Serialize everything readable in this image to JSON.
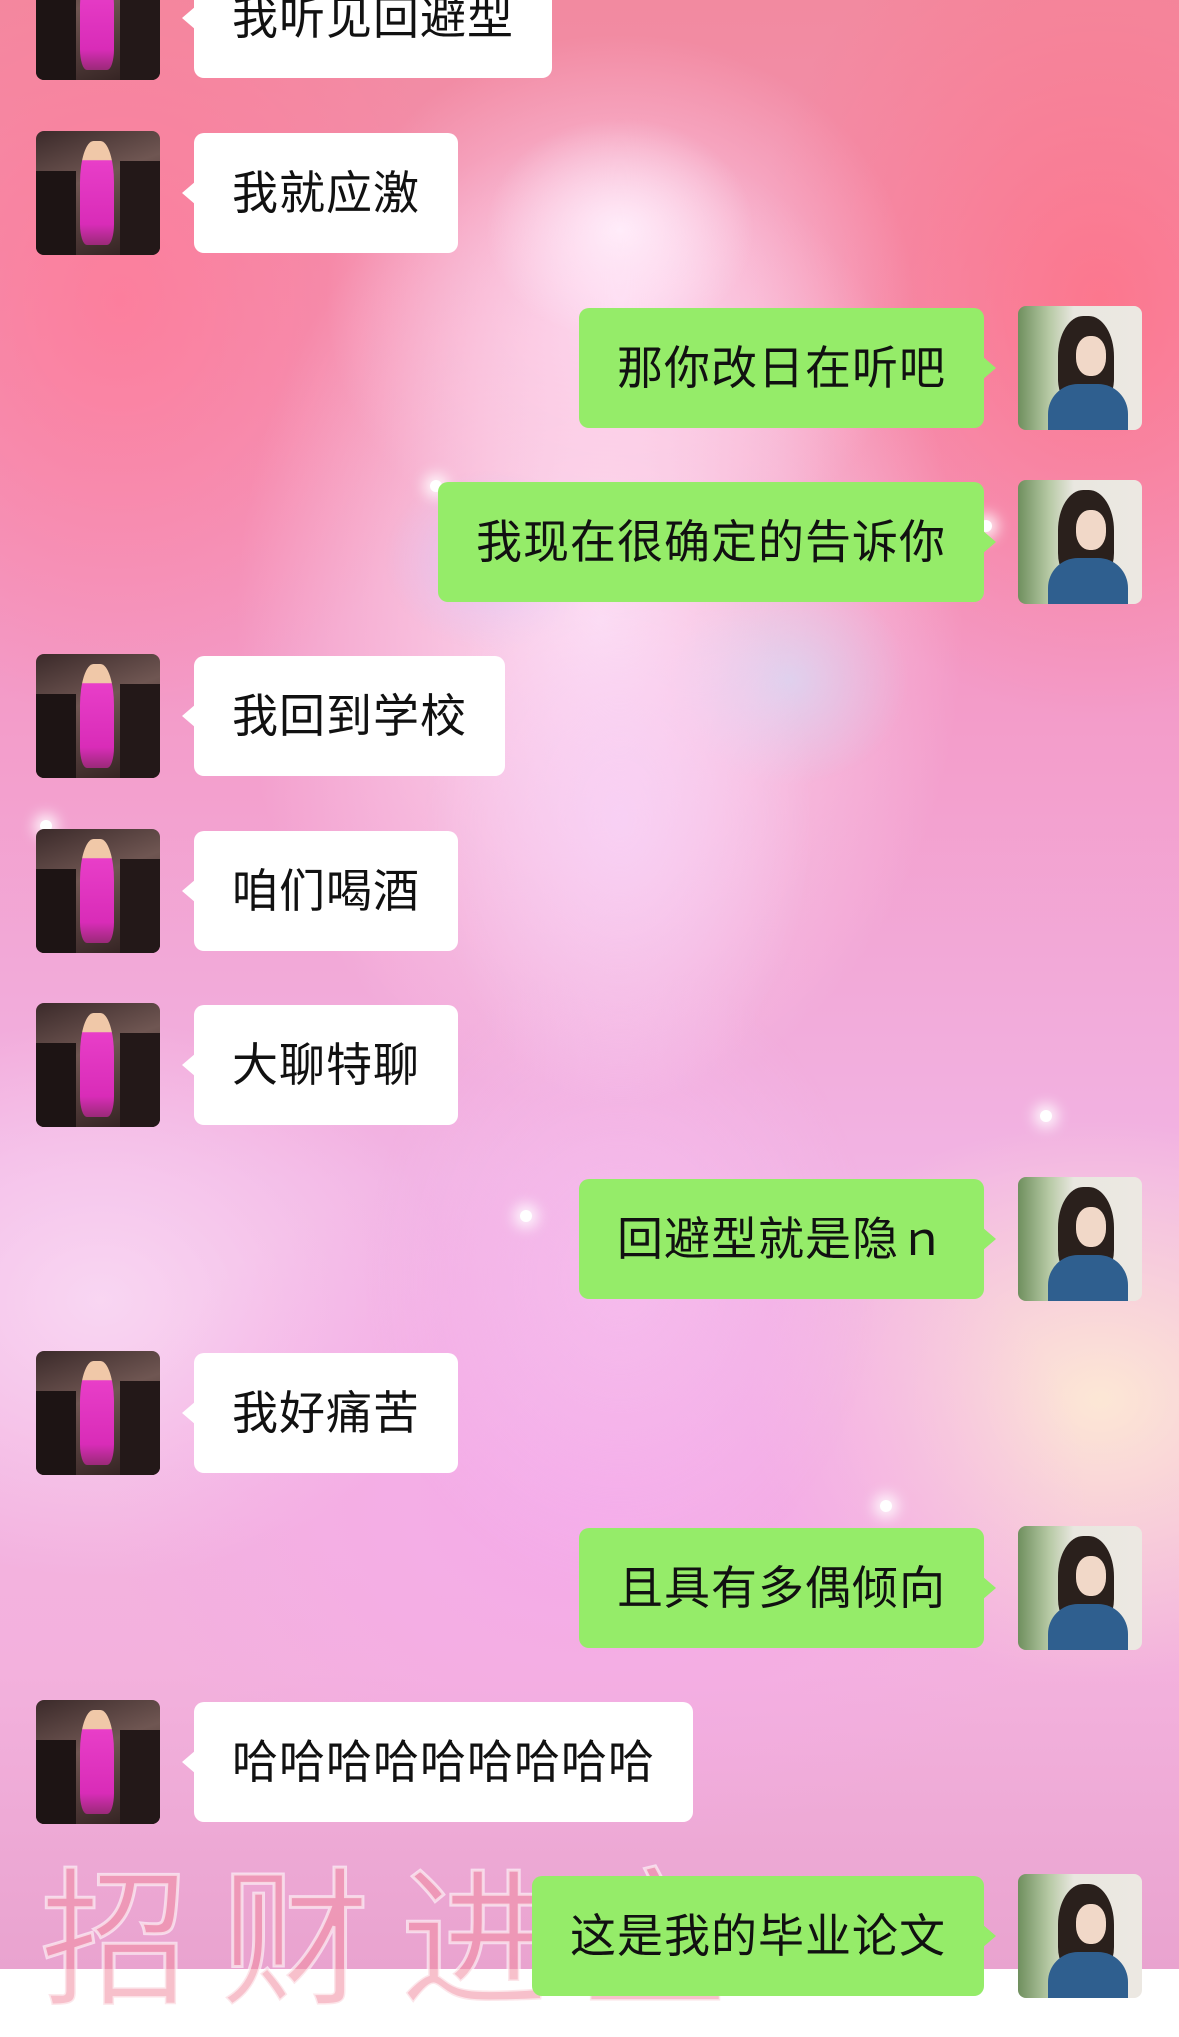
{
  "chat": {
    "messages": [
      {
        "side": "left",
        "text": "我听见回避型"
      },
      {
        "side": "left",
        "text": "我就应激"
      },
      {
        "side": "right",
        "text": "那你改日在听吧"
      },
      {
        "side": "right",
        "text": "我现在很确定的告诉你"
      },
      {
        "side": "left",
        "text": "我回到学校"
      },
      {
        "side": "left",
        "text": "咱们喝酒"
      },
      {
        "side": "left",
        "text": "大聊特聊"
      },
      {
        "side": "right",
        "text": "回避型就是隐ｎ"
      },
      {
        "side": "left",
        "text": "我好痛苦"
      },
      {
        "side": "right",
        "text": "且具有多偶倾向"
      },
      {
        "side": "left",
        "text": "哈哈哈哈哈哈哈哈哈"
      },
      {
        "side": "right",
        "text": "这是我的毕业论文"
      }
    ]
  },
  "colors": {
    "incoming_bubble": "#ffffff",
    "outgoing_bubble": "#95ec69"
  },
  "background": {
    "watermark": "招财进宝"
  }
}
